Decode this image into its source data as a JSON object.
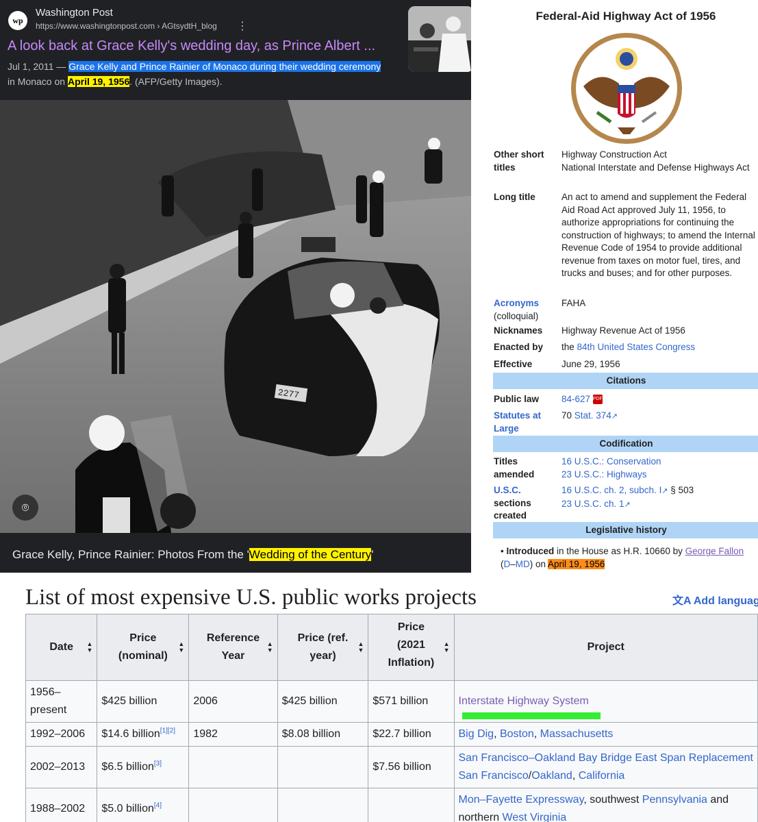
{
  "search_result": {
    "site_name": "Washington Post",
    "logo_text": "wp",
    "url": "https://www.washingtonpost.com › AGtsydtH_blog",
    "title": "A look back at Grace Kelly's wedding day, as Prince Albert ...",
    "snippet": {
      "date": "Jul 1, 2011",
      "dash": " — ",
      "hl1": "Grace Kelly and Prince Rainier of Monaco during their wedding ceremony",
      "line2_pre": "in Monaco on ",
      "hl2": "April 19, 1956",
      "line2_post": ". (AFP/Getty Images)."
    },
    "caption_pre": "Grace Kelly, Prince Rainier: Photos From the '",
    "caption_hl": "Wedding of the Century",
    "caption_post": "'",
    "photo_plate": "2277"
  },
  "infobox": {
    "title": "Federal-Aid Highway Act of 1956",
    "rows": {
      "other_short_titles": {
        "label": "Other short titles",
        "value1": "Highway Construction Act",
        "value2": "National Interstate and Defense Highways Act"
      },
      "long_title": {
        "label": "Long title",
        "value": "An act to amend and supplement the Federal Aid Road Act approved July 11, 1956, to authorize appropriations for continuing the construction of highways; to amend the Internal Revenue Code of 1954 to provide additional revenue from taxes on motor fuel, tires, and trucks and buses; and for other purposes."
      },
      "acronyms": {
        "label": "Acronyms",
        "sub": "(colloquial)",
        "value": "FAHA"
      },
      "nicknames": {
        "label": "Nicknames",
        "value": "Highway Revenue Act of 1956"
      },
      "enacted_by": {
        "label": "Enacted by",
        "pre": "the ",
        "link": "84th United States Congress"
      },
      "effective": {
        "label": "Effective",
        "value": "June 29, 1956"
      }
    },
    "citations": {
      "header": "Citations",
      "public_law": {
        "label": "Public law",
        "value": "84-627",
        "icon": "pdf-icon"
      },
      "statutes": {
        "label": "Statutes at Large",
        "pre": "70 ",
        "link": "Stat. 374"
      }
    },
    "codification": {
      "header": "Codification",
      "titles_amended": {
        "label": "Titles amended",
        "v1": "16 U.S.C.: Conservation",
        "v2": "23 U.S.C.: Highways"
      },
      "usc_sections": {
        "label_link": "U.S.C.",
        "label_rest": "sections created",
        "v1": "16 U.S.C. ch. 2, subch. I",
        "v1_post": " § 503",
        "v2": "23 U.S.C. ch. 1"
      }
    },
    "legislative_history": {
      "header": "Legislative history",
      "bullet": "Introduced",
      "text1": " in the House as H.R. 10660 by ",
      "person": "George Fallon",
      "paren_open": " (",
      "party": "D",
      "dash": "–",
      "state": "MD",
      "paren_close": ") on ",
      "date": "April 19, 1956"
    }
  },
  "wiki": {
    "title": "List of most expensive U.S. public works projects",
    "add_languages": "Add languages",
    "headers": {
      "date": "Date",
      "price_nominal_1": "Price",
      "price_nominal_2": "(nominal)",
      "ref_year_1": "Reference",
      "ref_year_2": "Year",
      "price_ref_1": "Price (ref.",
      "price_ref_2": "year)",
      "price_2021_1": "Price",
      "price_2021_2": "(2021",
      "price_2021_3": "Inflation)",
      "project": "Project"
    },
    "rows": [
      {
        "date1": "1956–",
        "date2": "present",
        "price": "$425 billion",
        "refs": "",
        "year": "2006",
        "price_ref": "$425 billion",
        "price_2021": "$571 billion",
        "project": "Interstate Highway System"
      },
      {
        "date": "1992–2006",
        "price": "$14.6 billion",
        "refs": "[1][2]",
        "year": "1982",
        "price_ref": "$8.08 billion",
        "price_2021": "$22.7 billion",
        "p1": "Big Dig",
        "p2": "Boston",
        "p3": "Massachusetts"
      },
      {
        "date": "2002–2013",
        "price": "$6.5 billion",
        "refs": "[3]",
        "year": "",
        "price_ref": "",
        "price_2021": "$7.56 billion",
        "p1": "San Francisco–Oakland Bay Bridge East Span Replacement",
        "p2": "San Francisco",
        "p3": "Oakland",
        "p4": "California"
      },
      {
        "date": "1988–2002",
        "price": "$5.0 billion",
        "refs": "[4]",
        "year": "",
        "price_ref": "",
        "price_2021": "",
        "p1": "Mon–Fayette Expressway",
        "p1_post": ", southwest ",
        "p2": "Pennsylvania",
        "p2_post": " and",
        "line2_pre": "northern ",
        "p3": "West Virginia"
      }
    ]
  }
}
